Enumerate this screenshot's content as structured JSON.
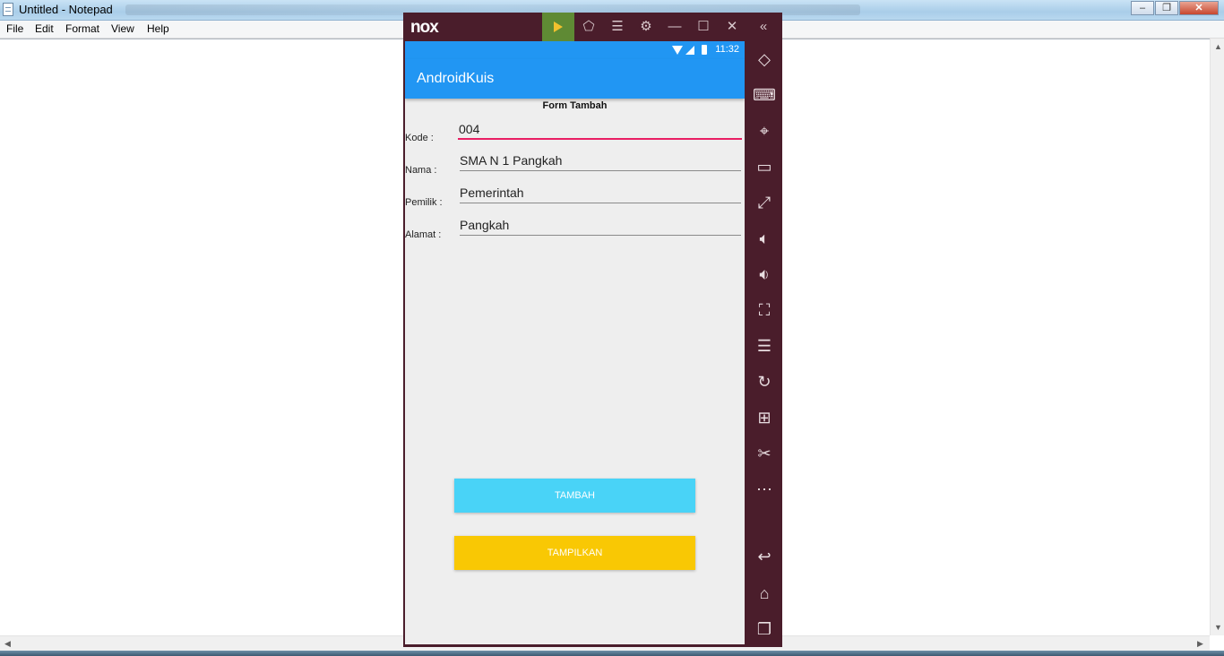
{
  "notepad": {
    "title": "Untitled - Notepad",
    "menu": [
      "File",
      "Edit",
      "Format",
      "View",
      "Help"
    ]
  },
  "nox": {
    "logo": "nox",
    "toolbar_icons": [
      "play-store-icon",
      "shirt-icon",
      "menu-icon",
      "settings-icon",
      "minimize-icon",
      "maximize-icon",
      "close-icon",
      "collapse-sidebar-icon"
    ],
    "sidebar_icons": [
      "rotate-icon",
      "keyboard-icon",
      "location-icon",
      "screen-icon",
      "fullscreen-icon",
      "volume-up-icon",
      "volume-down-icon",
      "screenshot-icon",
      "multi-instance-icon",
      "sync-icon",
      "apk-install-icon",
      "scissors-icon",
      "more-icon",
      "back-icon",
      "home-icon",
      "recent-apps-icon"
    ]
  },
  "android": {
    "status_time": "11:32",
    "app_title": "AndroidKuis",
    "form_title": "Form Tambah",
    "fields": [
      {
        "label": "Kode  :",
        "value": "004"
      },
      {
        "label": "Nama :",
        "value": "SMA N 1 Pangkah"
      },
      {
        "label": "Pemilik :",
        "value": "Pemerintah"
      },
      {
        "label": "Alamat :",
        "value": "Pangkah"
      }
    ],
    "buttons": {
      "tambah": "TAMBAH",
      "tampilkan": "TAMPILKAN"
    },
    "colors": {
      "primary": "#2196f3",
      "tambah": "#49d3f7",
      "tampilkan": "#f9c804",
      "focus_line": "#e91e63",
      "nox_frame": "#4a1d2b"
    }
  }
}
